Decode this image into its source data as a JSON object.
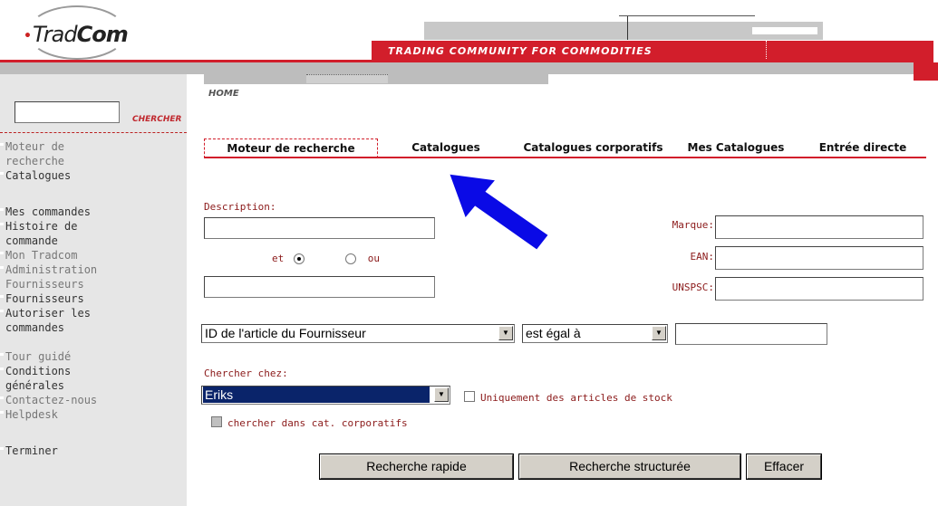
{
  "header": {
    "logo_text_1": "Trad",
    "logo_text_2": "Com",
    "banner": "TRADING COMMUNITY FOR COMMODITIES"
  },
  "sidebar": {
    "search_button": "CHERCHER",
    "items": [
      {
        "label": "Moteur de recherche",
        "dim": true
      },
      {
        "label": "Catalogues",
        "dim": false
      },
      {
        "label": "Mes commandes",
        "dim": false
      },
      {
        "label": "Histoire de commande",
        "dim": false
      },
      {
        "label": "Mon Tradcom",
        "dim": true
      },
      {
        "label": "Administration Fournisseurs",
        "dim": true
      },
      {
        "label": "Fournisseurs",
        "dim": false
      },
      {
        "label": "Autoriser les commandes",
        "dim": false
      },
      {
        "label": "Tour guidé",
        "dim": true
      },
      {
        "label": "Conditions générales",
        "dim": false
      },
      {
        "label": "Contactez-nous",
        "dim": true
      },
      {
        "label": "Helpdesk",
        "dim": true
      },
      {
        "label": "Terminer",
        "dim": false
      }
    ]
  },
  "breadcrumb": "HOME",
  "tabs": [
    {
      "label": "Moteur de recherche",
      "active": true
    },
    {
      "label": "Catalogues",
      "active": false
    },
    {
      "label": "Catalogues corporatifs",
      "active": false
    },
    {
      "label": "Mes Catalogues",
      "active": false
    },
    {
      "label": "Entrée directe",
      "active": false
    }
  ],
  "form": {
    "description_label": "Description:",
    "description_value": "",
    "description2_value": "",
    "radio_et": "et",
    "radio_ou": "ou",
    "radio_selected": "et",
    "marque_label": "Marque:",
    "ean_label": "EAN:",
    "unspsc_label": "UNSPSC:",
    "field_select": "ID de l'article du Fournisseur",
    "operator_select": "est égal à",
    "criteria_value": "",
    "chercher_chez_label": "Chercher chez:",
    "supplier_select": "Eriks",
    "stock_only_label": "Uniquement des articles de stock",
    "stock_only_checked": false,
    "corporate_label": "chercher dans cat. corporatifs",
    "corporate_disabled": true
  },
  "buttons": {
    "quick": "Recherche rapide",
    "structured": "Recherche structurée",
    "clear": "Effacer"
  },
  "colors": {
    "brand_red": "#d21e2b",
    "label_red": "#8b1a1a",
    "arrow_blue": "#0a0ae6",
    "selection_blue": "#0a246a"
  }
}
